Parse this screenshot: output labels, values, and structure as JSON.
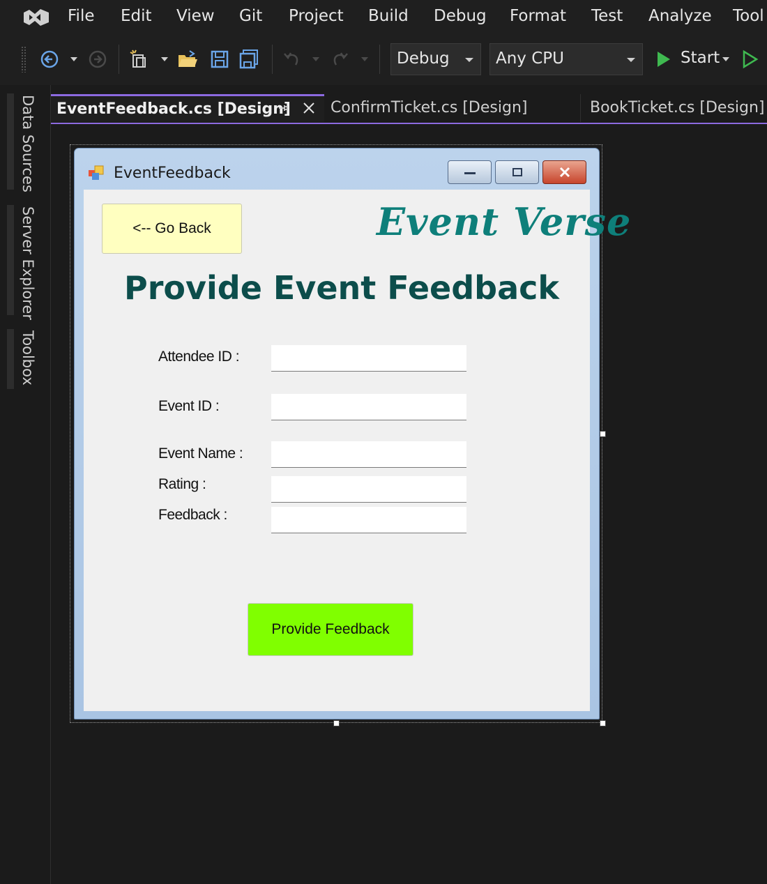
{
  "menu": {
    "items": [
      "File",
      "Edit",
      "View",
      "Git",
      "Project",
      "Build",
      "Debug",
      "Format",
      "Test",
      "Analyze",
      "Tool"
    ]
  },
  "toolbar": {
    "configuration": "Debug",
    "platform": "Any CPU",
    "start_label": "Start",
    "icons": [
      "back-icon",
      "forward-icon",
      "new-item-icon",
      "open-folder-icon",
      "save-icon",
      "save-all-icon",
      "undo-icon",
      "redo-icon",
      "start-icon",
      "start-without-debugging-icon"
    ]
  },
  "side_panels": [
    "Data Sources",
    "Server Explorer",
    "Toolbox"
  ],
  "tabs": [
    {
      "label": "EventFeedback.cs [Design]",
      "active": true
    },
    {
      "label": "ConfirmTicket.cs [Design]",
      "active": false
    },
    {
      "label": "BookTicket.cs [Design]",
      "active": false
    }
  ],
  "form": {
    "title": "EventFeedback",
    "go_back_label": "<-- Go Back",
    "brand": "Event Verse",
    "heading": "Provide Event Feedback",
    "fields": [
      {
        "label": "Attendee ID :",
        "value": ""
      },
      {
        "label": "Event ID :",
        "value": ""
      },
      {
        "label": "Event Name :",
        "value": ""
      },
      {
        "label": "Rating :",
        "value": ""
      },
      {
        "label": "Feedback :",
        "value": ""
      }
    ],
    "submit_label": "Provide Feedback"
  },
  "colors": {
    "accent_tab": "#8c6ae0",
    "brand_text": "#0e7f7a",
    "heading_text": "#0c4d4b",
    "go_back_bg": "#ffffc0",
    "submit_bg": "#80ff00",
    "start_green": "#3fb950"
  }
}
